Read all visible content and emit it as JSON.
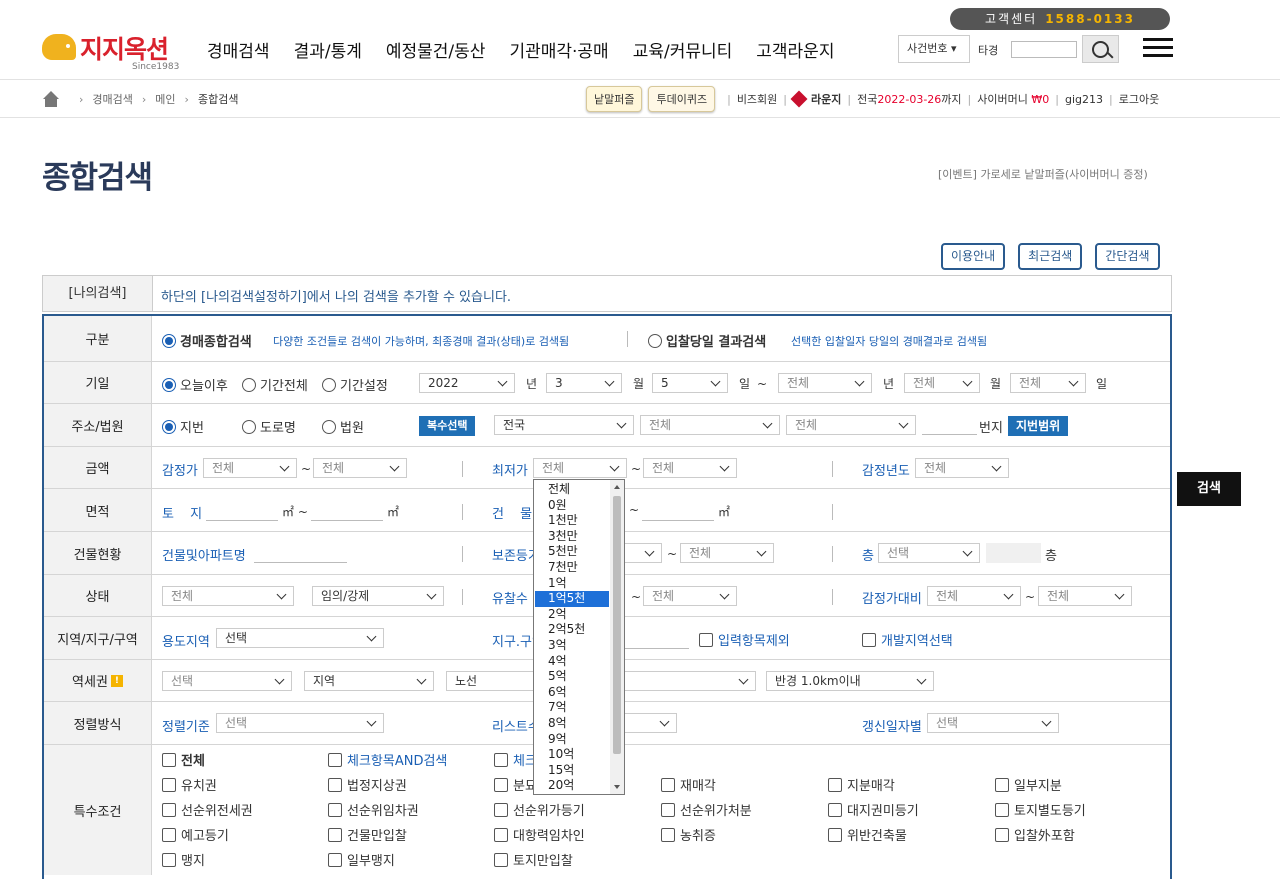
{
  "header": {
    "cs_label": "고객센터",
    "cs_number": "1588-0133",
    "logo_text": "지지옥션",
    "logo_since": "Since1983",
    "gnb": [
      "경매검색",
      "결과/통계",
      "예정물건/동산",
      "기관매각·공매",
      "교육/커뮤니티",
      "고객라운지"
    ],
    "search_select": "사건번호",
    "search_label": "타경",
    "search_value": ""
  },
  "subnav": {
    "crumbs": [
      "경매검색",
      "메인",
      "종합검색"
    ],
    "btn_puzzle": "낱말퍼즐",
    "btn_quiz": "투데이퀴즈",
    "biz": "비즈회원",
    "lounge": "라운지",
    "region": "전국",
    "date": "2022-03-26",
    "until": "까지",
    "cyber": "사이버머니",
    "cyber_amount": "₩0",
    "user": "gig213",
    "logout": "로그아웃"
  },
  "page": {
    "title": "종합검색",
    "event": "[이벤트] 가로세로 낱말퍼즐(사이버머니 증정)",
    "buttons": [
      "이용안내",
      "최근검색",
      "간단검색"
    ],
    "my_search_head": "[나의검색]",
    "my_search_text": "하단의 [나의검색설정하기]에서 나의 검색을 추가할 수 있습니다."
  },
  "form": {
    "gubun": {
      "label": "구분",
      "opt1": "경매종합검색",
      "opt1_note": "다양한 조건들로 검색이 가능하며, 최종경매 결과(상태)로 검색됨",
      "opt2": "입찰당일 결과검색",
      "opt2_note": "선택한 입찰일자 당일의 경매결과로 검색됨"
    },
    "giil": {
      "label": "기일",
      "r1": "오늘이후",
      "r2": "기간전체",
      "r3": "기간설정",
      "year": "2022",
      "year_u": "년",
      "month": "3",
      "month_u": "월",
      "day": "5",
      "day_u": "일",
      "tilde": "~",
      "all": "전체"
    },
    "addr": {
      "label": "주소/법원",
      "r1": "지번",
      "r2": "도로명",
      "r3": "법원",
      "multi": "복수선택",
      "sido": "전국",
      "all": "전체",
      "bunji": "번지",
      "range_btn": "지번범위"
    },
    "amount": {
      "label": "금액",
      "appraisal": "감정가",
      "min": "최저가",
      "year": "감정년도",
      "all": "전체",
      "tilde": "~"
    },
    "area": {
      "label": "면적",
      "land": "토 지",
      "bldg": "건 물",
      "unit": "㎡"
    },
    "building": {
      "label": "건물현황",
      "name": "건물및아파트명",
      "reg": "보존등기",
      "floor": "층",
      "floor_sel": "선택",
      "all": "전체"
    },
    "status": {
      "label": "상태",
      "all": "전체",
      "type": "임의/강제",
      "fail": "유찰수",
      "ratio": "감정가대비"
    },
    "zone": {
      "label": "지역/지구/구역",
      "use": "용도지역",
      "sel": "선택",
      "district": "지구.구역",
      "exclude": "입력항목제외",
      "dev": "개발지역선택"
    },
    "station": {
      "label": "역세권",
      "sel": "선택",
      "region": "지역",
      "line": "노선",
      "radius": "반경 1.0km이내"
    },
    "sort": {
      "label": "정렬방식",
      "base": "정렬기준",
      "list": "리스트수",
      "update": "갱신일자별",
      "sel": "선택"
    },
    "special": {
      "label": "특수조건",
      "items": [
        [
          "전체",
          "체크항목AND검색",
          "체크",
          "",
          "",
          ""
        ],
        [
          "유치권",
          "법정지상권",
          "분묘",
          "재매각",
          "지분매각",
          "일부지분"
        ],
        [
          "선순위전세권",
          "선순위임차권",
          "선순위가등기",
          "선순위가처분",
          "대지권미등기",
          "토지별도등기"
        ],
        [
          "예고등기",
          "건물만입찰",
          "대항력임차인",
          "농취증",
          "위반건축물",
          "입찰外포함"
        ],
        [
          "맹지",
          "일부맹지",
          "토지만입찰",
          "",
          "",
          ""
        ]
      ]
    }
  },
  "dropdown": {
    "options": [
      "전체",
      "0원",
      "1천만",
      "3천만",
      "5천만",
      "7천만",
      "1억",
      "1억5천",
      "2억",
      "2억5천",
      "3억",
      "4억",
      "5억",
      "6억",
      "7억",
      "8억",
      "9억",
      "10억",
      "15억",
      "20억"
    ],
    "selected_index": 7
  },
  "side_button": "검색"
}
